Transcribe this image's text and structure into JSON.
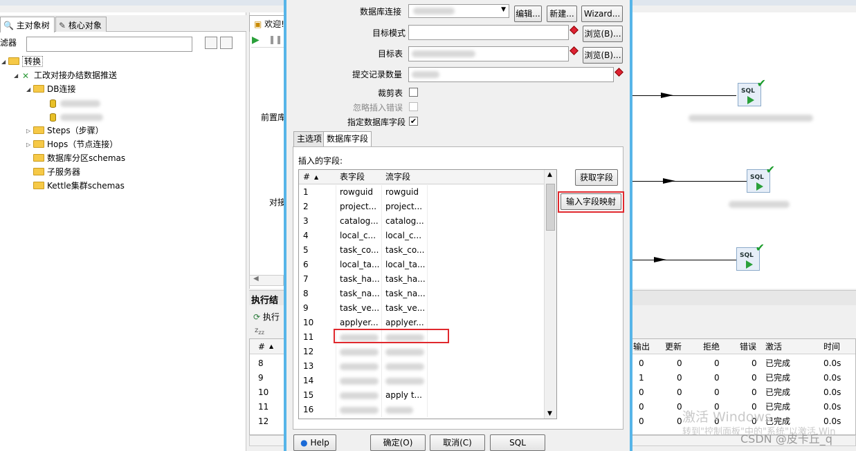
{
  "left": {
    "tabs": [
      {
        "label": "主对象树",
        "icon": "tree-icon"
      },
      {
        "label": "核心对象",
        "icon": "pencil-icon"
      }
    ],
    "filter_label": "滤器",
    "tree": [
      {
        "label": "转换"
      },
      {
        "label": "工改对接办结数据推送"
      },
      {
        "label": "DB连接"
      },
      {
        "label": "Steps（步骤）"
      },
      {
        "label": "Hops（节点连接）"
      },
      {
        "label": "数据库分区schemas"
      },
      {
        "label": "子服务器"
      },
      {
        "label": "Kettle集群schemas"
      }
    ]
  },
  "canvas": {
    "tab_label": "欢迎!",
    "side_labels": [
      "前置库",
      "对接"
    ]
  },
  "exec": {
    "title": "执行结",
    "sub_label": "执行",
    "columns": [
      "#",
      "输出",
      "更新",
      "拒绝",
      "错误",
      "激活",
      "时间"
    ],
    "rows": [
      {
        "n": "8",
        "out": "0",
        "upd": "0",
        "rej": "0",
        "err": "0",
        "status": "已完成",
        "time": "0.0s"
      },
      {
        "n": "9",
        "out": "1",
        "upd": "0",
        "rej": "0",
        "err": "0",
        "status": "已完成",
        "time": "0.0s"
      },
      {
        "n": "10",
        "out": "0",
        "upd": "0",
        "rej": "0",
        "err": "0",
        "status": "已完成",
        "time": "0.0s"
      },
      {
        "n": "11",
        "out": "0",
        "upd": "0",
        "rej": "0",
        "err": "0",
        "status": "已完成",
        "time": "0.0s"
      },
      {
        "n": "12",
        "out": "0",
        "upd": "0",
        "rej": "0",
        "err": "0",
        "status": "已完成",
        "time": "0.0s"
      }
    ]
  },
  "dialog": {
    "db_conn_label": "数据库连接",
    "edit_btn": "编辑...",
    "new_btn": "新建...",
    "wizard_btn": "Wizard...",
    "schema_label": "目标模式",
    "browse_btn": "浏览(B)...",
    "table_label": "目标表",
    "commit_label": "提交记录数量",
    "truncate_label": "裁剪表",
    "ignore_label": "忽略插入错误",
    "specify_label": "指定数据库字段",
    "tabs": [
      "主选项",
      "数据库字段"
    ],
    "fields_title": "插入的字段:",
    "columns": [
      "#",
      "表字段",
      "流字段"
    ],
    "rows": [
      {
        "n": "1",
        "table": "rowguid",
        "stream": "rowguid"
      },
      {
        "n": "2",
        "table": "project...",
        "stream": "project..."
      },
      {
        "n": "3",
        "table": "catalog...",
        "stream": "catalog..."
      },
      {
        "n": "4",
        "table": "local_c...",
        "stream": "local_c..."
      },
      {
        "n": "5",
        "table": "task_co...",
        "stream": "task_co..."
      },
      {
        "n": "6",
        "table": "local_ta...",
        "stream": "local_ta..."
      },
      {
        "n": "7",
        "table": "task_ha...",
        "stream": "task_ha..."
      },
      {
        "n": "8",
        "table": "task_na...",
        "stream": "task_na..."
      },
      {
        "n": "9",
        "table": "task_ve...",
        "stream": "task_ve..."
      },
      {
        "n": "10",
        "table": "applyer...",
        "stream": "applyer..."
      },
      {
        "n": "11",
        "table": "",
        "stream": ""
      },
      {
        "n": "12",
        "table": "",
        "stream": ""
      },
      {
        "n": "13",
        "table": "",
        "stream": ""
      },
      {
        "n": "14",
        "table": "",
        "stream": ""
      },
      {
        "n": "15",
        "table": "",
        "stream": "apply t..."
      },
      {
        "n": "16",
        "table": "",
        "stream": ""
      }
    ],
    "get_fields_btn": "获取字段",
    "map_btn": "输入字段映射",
    "help_btn": "Help",
    "ok_btn": "确定(O)",
    "cancel_btn": "取消(C)",
    "sql_btn": "SQL"
  },
  "watermark": {
    "activate_title": "激活 Windows",
    "activate_sub": "转到\"控制面板\"中的\"系统\"以激活 Win",
    "csdn": "CSDN @皮卡丘_q"
  }
}
